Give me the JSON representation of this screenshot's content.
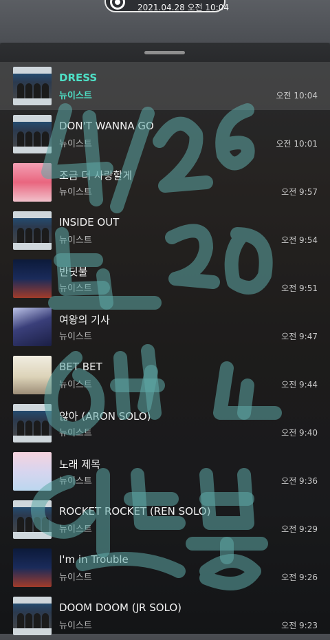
{
  "status": {
    "datetime": "2021.04.28 오전 10:04"
  },
  "songs": [
    {
      "title": "DRESS",
      "artist": "뉴이스트",
      "time": "오전 10:04",
      "art": "dress"
    },
    {
      "title": "DON'T WANNA GO",
      "artist": "뉴이스트",
      "time": "오전 10:01",
      "art": "dress"
    },
    {
      "title": "조금 더 사랑할게",
      "artist": "뉴이스트",
      "time": "오전 9:57",
      "art": "pink"
    },
    {
      "title": "INSIDE OUT",
      "artist": "뉴이스트",
      "time": "오전 9:54",
      "art": "dress"
    },
    {
      "title": "반딧불",
      "artist": "뉴이스트",
      "time": "오전 9:51",
      "art": "night"
    },
    {
      "title": "여왕의 기사",
      "artist": "뉴이스트",
      "time": "오전 9:47",
      "art": "queen"
    },
    {
      "title": "BET BET",
      "artist": "뉴이스트",
      "time": "오전 9:44",
      "art": "cream"
    },
    {
      "title": "않아 (ARON SOLO)",
      "artist": "뉴이스트",
      "time": "오전 9:40",
      "art": "dress"
    },
    {
      "title": "노래 제목",
      "artist": "뉴이스트",
      "time": "오전 9:36",
      "art": "pastel"
    },
    {
      "title": "ROCKET ROCKET (REN SOLO)",
      "artist": "뉴이스트",
      "time": "오전 9:29",
      "art": "dress"
    },
    {
      "title": "I'm in Trouble",
      "artist": "뉴이스트",
      "time": "오전 9:26",
      "art": "night"
    },
    {
      "title": "DOOM DOOM (JR SOLO)",
      "artist": "뉴이스트",
      "time": "오전 9:23",
      "art": "dress"
    }
  ],
  "colors": {
    "accent": "#4ee0c6",
    "scribble": "#5fa9a8"
  },
  "handwriting_overlay": "4/26 뜨20 인드니 인더봄"
}
